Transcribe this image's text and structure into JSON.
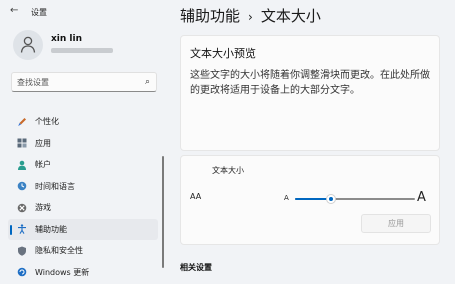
{
  "window": {
    "title": "设置"
  },
  "user": {
    "name": "xin lin"
  },
  "search": {
    "placeholder": "查找设置"
  },
  "sidebar": {
    "items": [
      {
        "label": "个性化",
        "icon": "brush-icon"
      },
      {
        "label": "应用",
        "icon": "apps-icon"
      },
      {
        "label": "帐户",
        "icon": "person-icon"
      },
      {
        "label": "时间和语言",
        "icon": "globe-clock-icon"
      },
      {
        "label": "游戏",
        "icon": "xbox-icon"
      },
      {
        "label": "辅助功能",
        "icon": "accessibility-icon",
        "selected": true
      },
      {
        "label": "隐私和安全性",
        "icon": "shield-icon"
      },
      {
        "label": "Windows 更新",
        "icon": "update-icon"
      }
    ]
  },
  "breadcrumb": {
    "parent": "辅助功能",
    "separator": "›",
    "current": "文本大小"
  },
  "preview": {
    "title": "文本大小预览",
    "body": "这些文字的大小将随着你调整滑块而更改。在此处所做的更改将适用于设备上的大部分文字。"
  },
  "text_size": {
    "label": "文本大小",
    "icon_text": "AA",
    "small_a": "A",
    "big_a": "A",
    "slider_fraction": 0.3,
    "apply_label": "应用"
  },
  "related": {
    "title": "相关设置"
  },
  "colors": {
    "accent": "#0067c0"
  }
}
